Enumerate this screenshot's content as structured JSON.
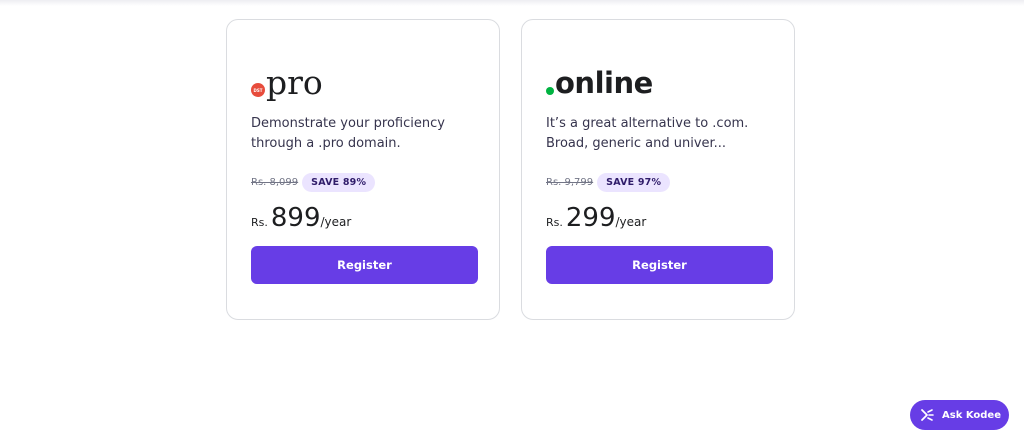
{
  "cards": [
    {
      "logo_text": "pro",
      "logo_badge": "DST",
      "description": "Demonstrate your proficiency through a .pro domain.",
      "old_price": "Rs. 8,099",
      "save_label": "SAVE 89%",
      "currency": "Rs.",
      "price": "899",
      "period": "/year",
      "button_label": "Register"
    },
    {
      "logo_text": "online",
      "description": "It’s a great alternative to .com. Broad, generic and univer...",
      "old_price": "Rs. 9,799",
      "save_label": "SAVE 97%",
      "currency": "Rs.",
      "price": "299",
      "period": "/year",
      "button_label": "Register"
    }
  ],
  "assistant": {
    "label": "Ask Kodee"
  },
  "colors": {
    "accent": "#673de6",
    "save_bg": "#ebe4ff",
    "pro_dot": "#e74c3c",
    "online_dot": "#00b341"
  }
}
